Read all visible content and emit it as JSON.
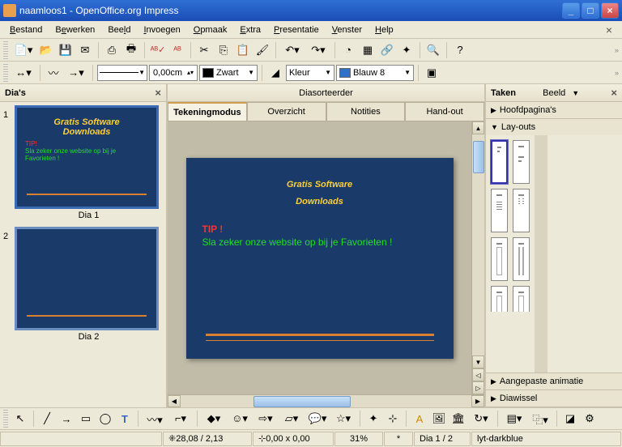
{
  "title": "naamloos1 - OpenOffice.org Impress",
  "menu": [
    "Bestand",
    "Bewerken",
    "Beeld",
    "Invoegen",
    "Opmaak",
    "Extra",
    "Presentatie",
    "Venster",
    "Help"
  ],
  "menu_accel": [
    0,
    1,
    3,
    0,
    0,
    0,
    0,
    0,
    0
  ],
  "toolbar2": {
    "line_width": "0,00cm",
    "color1": "Zwart",
    "fill_type": "Kleur",
    "fill_color": "Blauw 8"
  },
  "left": {
    "title": "Dia's",
    "slides": [
      {
        "num": "1",
        "title1": "Gratis Software",
        "title2": "Downloads",
        "tip": "TIP!",
        "text": "Sla zeker onze website op bij je Favorieten !",
        "caption": "Dia 1"
      },
      {
        "num": "2",
        "caption": "Dia 2"
      }
    ]
  },
  "center": {
    "topTab": "Diasorteerder",
    "tabs": [
      "Tekeningmodus",
      "Overzicht",
      "Notities",
      "Hand-out"
    ],
    "activeTab": 0,
    "slide": {
      "title1": "Gratis Software",
      "title2": "Downloads",
      "tip": "TIP !",
      "text": "Sla zeker onze website op bij je Favorieten !"
    }
  },
  "right": {
    "title": "Taken",
    "viewLabel": "Beeld",
    "sections": [
      "Hoofdpagina's",
      "Lay-outs",
      "Aangepaste animatie",
      "Diawissel"
    ],
    "openSection": 1
  },
  "status": {
    "pos": "28,08 / 2,13",
    "size": "0,00 x 0,00",
    "zoom": "31%",
    "modified": "*",
    "slide": "Dia 1 / 2",
    "layout": "lyt-darkblue"
  }
}
